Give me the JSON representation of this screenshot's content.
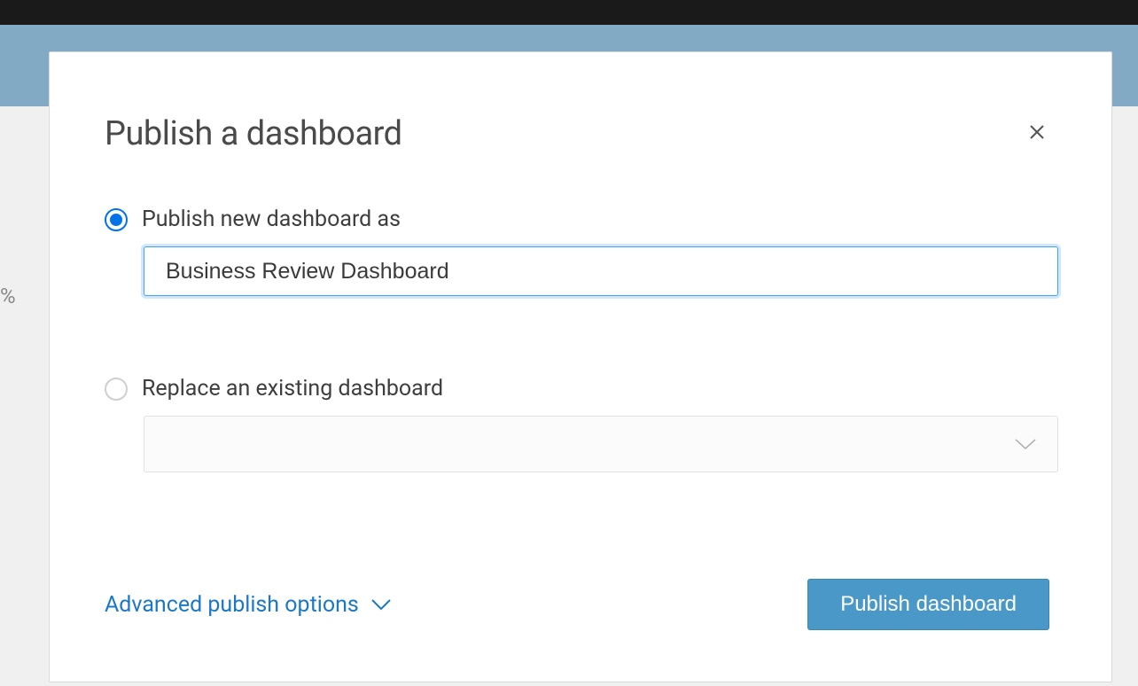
{
  "modal": {
    "title": "Publish a dashboard",
    "options": {
      "publish_new": {
        "label": "Publish new dashboard as",
        "value": "Business Review Dashboard",
        "selected": true
      },
      "replace_existing": {
        "label": "Replace an existing dashboard",
        "selected": false
      }
    },
    "advanced_link": "Advanced publish options",
    "publish_button": "Publish dashboard"
  },
  "background": {
    "percent_symbol": "%"
  }
}
